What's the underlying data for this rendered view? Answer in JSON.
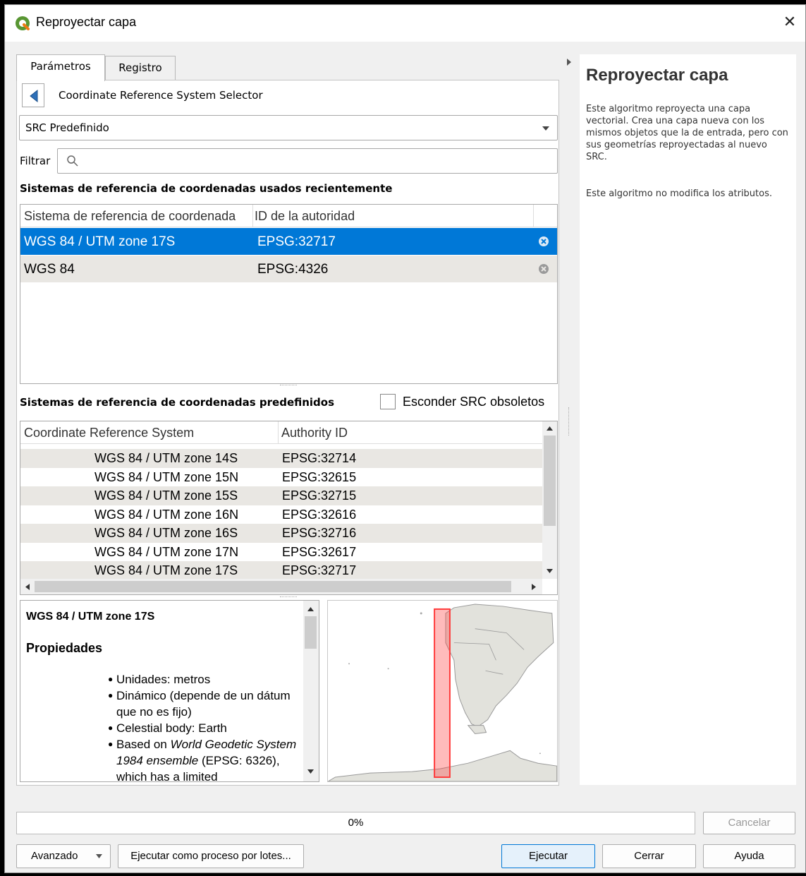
{
  "window": {
    "title": "Reproyectar capa",
    "close": "✕"
  },
  "tabs": [
    {
      "label": "Parámetros"
    },
    {
      "label": "Registro"
    }
  ],
  "crs_selector": {
    "title": "Coordinate Reference System Selector",
    "mode": "SRC Predefinido"
  },
  "filter": {
    "label": "Filtrar",
    "value": ""
  },
  "recent": {
    "section_title": "Sistemas de referencia de coordenadas usados recientemente",
    "col1": "Sistema de referencia de coordenada",
    "col2": "ID de la autoridad",
    "rows": [
      {
        "name": "WGS 84 / UTM zone 17S",
        "id": "EPSG:32717"
      },
      {
        "name": "WGS 84",
        "id": "EPSG:4326"
      }
    ]
  },
  "predefined": {
    "section_title": "Sistemas de referencia de coordenadas predefinidos",
    "hide_deprecated": "Esconder SRC obsoletos",
    "col1": "Coordinate Reference System",
    "col2": "Authority ID",
    "rows": [
      {
        "name": "WGS 84 / UTM zone 14S",
        "id": "EPSG:32714"
      },
      {
        "name": "WGS 84 / UTM zone 15N",
        "id": "EPSG:32615"
      },
      {
        "name": "WGS 84 / UTM zone 15S",
        "id": "EPSG:32715"
      },
      {
        "name": "WGS 84 / UTM zone 16N",
        "id": "EPSG:32616"
      },
      {
        "name": "WGS 84 / UTM zone 16S",
        "id": "EPSG:32716"
      },
      {
        "name": "WGS 84 / UTM zone 17N",
        "id": "EPSG:32617"
      },
      {
        "name": "WGS 84 / UTM zone 17S",
        "id": "EPSG:32717"
      }
    ]
  },
  "details": {
    "crs_name": "WGS 84 / UTM zone 17S",
    "props_heading": "Propiedades",
    "bullets": [
      "Unidades: metros",
      "Dinámico (depende de un dátum que no es fijo)",
      "Celestial body: Earth"
    ],
    "based_prefix": "Based on ",
    "based_italic": "World Geodetic System 1984 ensemble",
    "based_suffix": " (EPSG: 6326), which has a limited"
  },
  "help": {
    "title": "Reproyectar capa",
    "para1": "Este algoritmo reproyecta una capa vectorial. Crea una capa nueva con los mismos objetos que la de entrada, pero con sus geometrías reproyectadas al nuevo SRC.",
    "para2": "Este algoritmo no modifica los atributos."
  },
  "progress": {
    "value": 0,
    "label": "0%"
  },
  "buttons": {
    "cancel": "Cancelar",
    "advanced": "Avanzado",
    "batch": "Ejecutar como proceso por lotes...",
    "run": "Ejecutar",
    "close": "Cerrar",
    "help": "Ayuda"
  },
  "colors": {
    "selection": "#0078d7",
    "alt_row": "#e9e7e3",
    "extent": "#ff3b3b"
  }
}
